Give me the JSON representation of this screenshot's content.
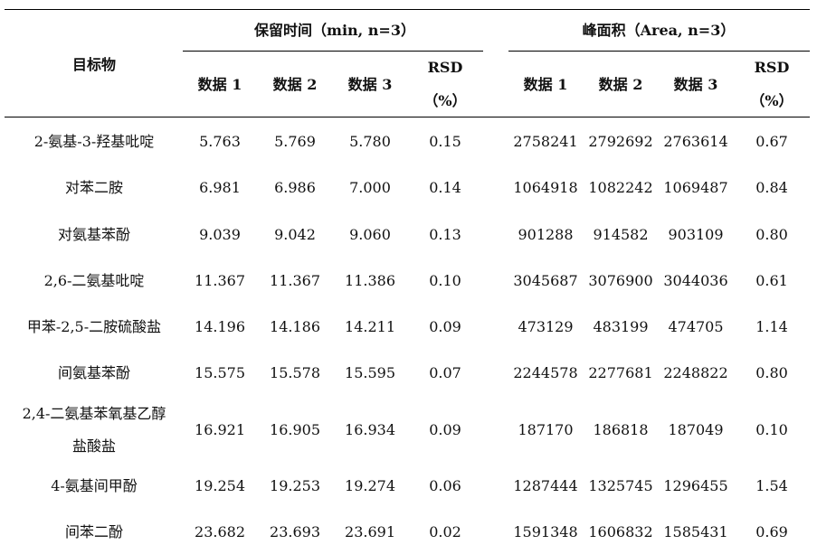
{
  "table": {
    "header": {
      "target_label": "目标物",
      "rt_group": "保留时间（min, n=3）",
      "area_group": "峰面积（Area, n=3）",
      "data1": "数据 1",
      "data2": "数据 2",
      "data3": "数据 3",
      "rsd": "RSD",
      "rsd_unit": "（%）"
    },
    "rows": [
      {
        "name": "2-氨基-3-羟基吡啶",
        "rt": [
          "5.763",
          "5.769",
          "5.780"
        ],
        "rt_rsd": "0.15",
        "area": [
          "2758241",
          "2792692",
          "2763614"
        ],
        "area_rsd": "0.67"
      },
      {
        "name": "对苯二胺",
        "rt": [
          "6.981",
          "6.986",
          "7.000"
        ],
        "rt_rsd": "0.14",
        "area": [
          "1064918",
          "1082242",
          "1069487"
        ],
        "area_rsd": "0.84"
      },
      {
        "name": "对氨基苯酚",
        "rt": [
          "9.039",
          "9.042",
          "9.060"
        ],
        "rt_rsd": "0.13",
        "area": [
          "901288",
          "914582",
          "903109"
        ],
        "area_rsd": "0.80"
      },
      {
        "name": "2,6-二氨基吡啶",
        "rt": [
          "11.367",
          "11.367",
          "11.386"
        ],
        "rt_rsd": "0.10",
        "area": [
          "3045687",
          "3076900",
          "3044036"
        ],
        "area_rsd": "0.61"
      },
      {
        "name": "甲苯-2,5-二胺硫酸盐",
        "rt": [
          "14.196",
          "14.186",
          "14.211"
        ],
        "rt_rsd": "0.09",
        "area": [
          "473129",
          "483199",
          "474705"
        ],
        "area_rsd": "1.14"
      },
      {
        "name": "间氨基苯酚",
        "rt": [
          "15.575",
          "15.578",
          "15.595"
        ],
        "rt_rsd": "0.07",
        "area": [
          "2244578",
          "2277681",
          "2248822"
        ],
        "area_rsd": "0.80"
      },
      {
        "name": "2,4-二氨基苯氧基乙醇",
        "name2": "盐酸盐",
        "rt": [
          "16.921",
          "16.905",
          "16.934"
        ],
        "rt_rsd": "0.09",
        "area": [
          "187170",
          "186818",
          "187049"
        ],
        "area_rsd": "0.10"
      },
      {
        "name": "4-氨基间甲酚",
        "rt": [
          "19.254",
          "19.253",
          "19.274"
        ],
        "rt_rsd": "0.06",
        "area": [
          "1287444",
          "1325745",
          "1296455"
        ],
        "area_rsd": "1.54"
      },
      {
        "name": "间苯二酚",
        "rt": [
          "23.682",
          "23.693",
          "23.691"
        ],
        "rt_rsd": "0.02",
        "area": [
          "1591348",
          "1606832",
          "1585431"
        ],
        "area_rsd": "0.69"
      }
    ]
  }
}
